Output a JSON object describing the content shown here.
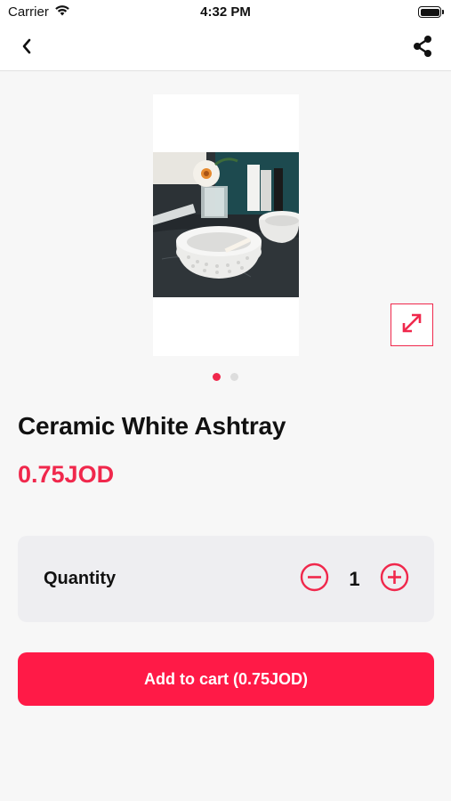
{
  "status_bar": {
    "carrier": "Carrier",
    "time": "4:32 PM",
    "icons": [
      "wifi-icon",
      "battery-icon"
    ]
  },
  "nav": {
    "icons": [
      "chevron-left-icon",
      "share-icon"
    ]
  },
  "gallery": {
    "image_count": 2,
    "active_index": 0,
    "image_subject": "white ceramic ashtrays with a flower vase",
    "expand_icon": "expand-arrows-icon"
  },
  "product": {
    "title": "Ceramic White Ashtray",
    "price": "0.75JOD"
  },
  "quantity": {
    "label": "Quantity",
    "value": "1",
    "icons": [
      "minus-circle-icon",
      "plus-circle-icon"
    ]
  },
  "cart": {
    "button_label": "Add to cart (0.75JOD)"
  },
  "colors": {
    "accent": "#f0284c",
    "button": "#ff1a47",
    "background": "#f7f7f7",
    "card": "#eeeef1"
  }
}
